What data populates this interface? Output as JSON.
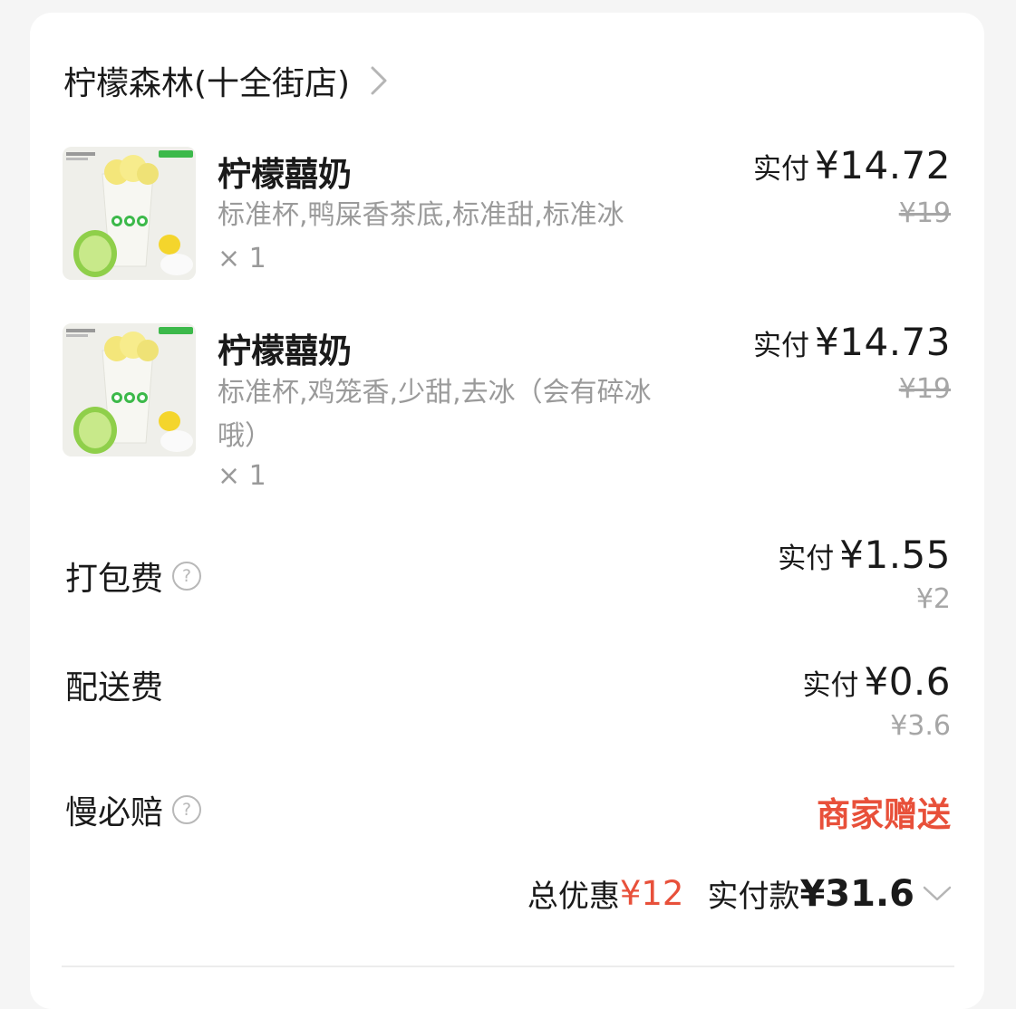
{
  "store": {
    "name": "柠檬森林(十全街店)"
  },
  "items": [
    {
      "name": "柠檬囍奶",
      "spec": "标准杯,鸭屎香茶底,标准甜,标准冰",
      "qty": "× 1",
      "paid_label": "实付",
      "paid_amount": "¥14.72",
      "original_price": "¥19",
      "image_icon": "lemon-milk-tea-cup"
    },
    {
      "name": "柠檬囍奶",
      "spec": "标准杯,鸡笼香,少甜,去冰（会有碎冰哦）",
      "qty": "× 1",
      "paid_label": "实付",
      "paid_amount": "¥14.73",
      "original_price": "¥19",
      "image_icon": "lemon-milk-tea-cup"
    }
  ],
  "fees": {
    "packing": {
      "label": "打包费",
      "paid_label": "实付",
      "paid_amount": "¥1.55",
      "original": "¥2"
    },
    "delivery": {
      "label": "配送费",
      "paid_label": "实付",
      "paid_amount": "¥0.6",
      "original": "¥3.6"
    },
    "late_guarantee": {
      "label": "慢必赔",
      "value": "商家赠送"
    }
  },
  "summary": {
    "discount_label": "总优惠",
    "discount_amount": "¥12",
    "paid_label": "实付款",
    "paid_amount": "¥31.6"
  },
  "colors": {
    "accent_red": "#e8503a",
    "text_primary": "#1a1a1a",
    "text_secondary": "#9a9a9a",
    "background": "#f5f5f5",
    "card": "#ffffff"
  },
  "icons": {
    "help": "?",
    "store_chevron": "chevron-right-icon",
    "summary_chevron": "chevron-down-icon"
  }
}
